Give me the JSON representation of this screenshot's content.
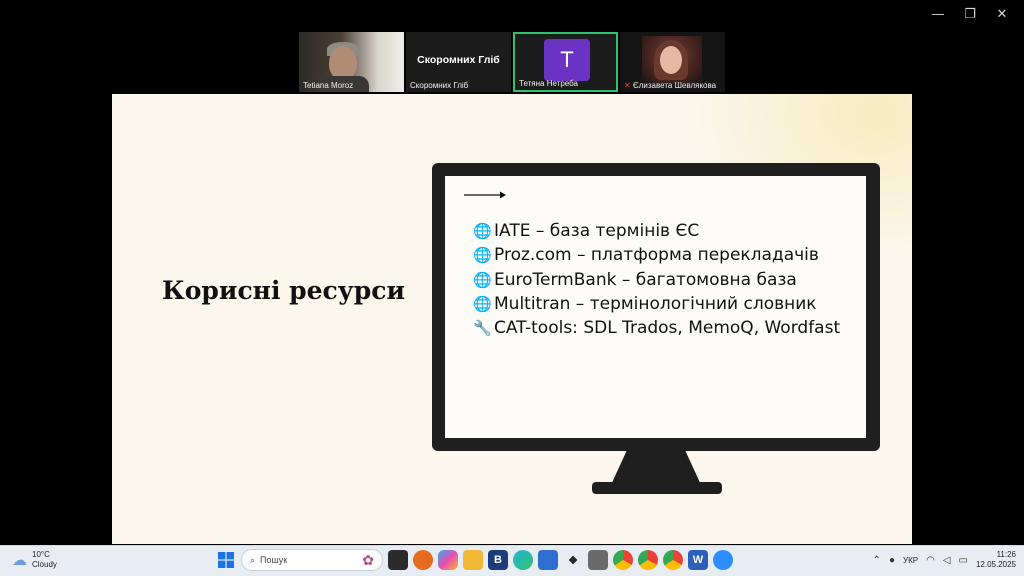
{
  "window_controls": {
    "minimize": "—",
    "restore": "❐",
    "close": "✕"
  },
  "participants": [
    {
      "name": "Tetiana Moroz",
      "type": "video"
    },
    {
      "name": "Скоромних Гліб",
      "display_title": "Скоромних Гліб",
      "type": "name"
    },
    {
      "name": "Тетяна Нетреба",
      "avatar_letter": "T",
      "type": "avatar",
      "active": true
    },
    {
      "name": "Єлизавета Шевлякова",
      "type": "video",
      "muted": true
    }
  ],
  "slide": {
    "title": "Корисні ресурси",
    "items": [
      {
        "icon": "globe-icon",
        "glyph": "🌐",
        "text": "IATE – база термінів ЄС"
      },
      {
        "icon": "globe-icon",
        "glyph": "🌐",
        "text": "Proz.com – платформа перекладачів"
      },
      {
        "icon": "globe-icon",
        "glyph": "🌐",
        "text": "EuroTermBank – багатомовна база"
      },
      {
        "icon": "globe-icon",
        "glyph": "🌐",
        "text": "Multitran – термінологічний словник"
      },
      {
        "icon": "wrench-icon",
        "glyph": "🔧",
        "text": "CAT-tools: SDL Trados, MemoQ, Wordfast"
      }
    ]
  },
  "taskbar": {
    "weather": {
      "temp": "10°C",
      "condition": "Cloudy"
    },
    "search_placeholder": "Пошук",
    "apps": [
      {
        "name": "start",
        "label": ""
      },
      {
        "name": "task-view",
        "label": ""
      },
      {
        "name": "firefox",
        "label": ""
      },
      {
        "name": "copilot",
        "label": ""
      },
      {
        "name": "file-explorer",
        "label": ""
      },
      {
        "name": "b-app",
        "label": "B"
      },
      {
        "name": "edge",
        "label": ""
      },
      {
        "name": "store",
        "label": ""
      },
      {
        "name": "dropbox",
        "label": ""
      },
      {
        "name": "app-folder",
        "label": ""
      },
      {
        "name": "chrome-1",
        "label": ""
      },
      {
        "name": "chrome-2",
        "label": ""
      },
      {
        "name": "chrome-3",
        "label": ""
      },
      {
        "name": "word",
        "label": "W"
      },
      {
        "name": "zoom",
        "label": ""
      }
    ],
    "language": "УКР",
    "time": "11:26",
    "date": "12.05.2025"
  },
  "colors": {
    "accent_active": "#2ec26b",
    "avatar": "#6b33c4",
    "slide_bg": "#fbf7ec"
  }
}
